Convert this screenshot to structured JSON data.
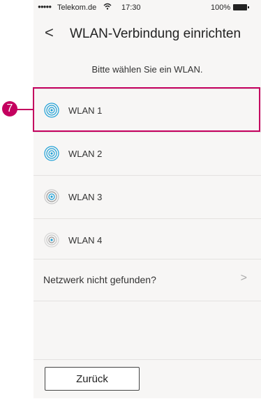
{
  "status_bar": {
    "signal_dots": "●●●●●",
    "carrier": "Telekom.de",
    "wifi_icon": "wifi-icon",
    "time": "17:30",
    "battery": "100%"
  },
  "nav": {
    "back_glyph": "<",
    "title": "WLAN-Verbindung einrichten"
  },
  "prompt": "Bitte wählen Sie ein WLAN.",
  "networks": [
    {
      "label": "WLAN 1",
      "strength": "strong"
    },
    {
      "label": "WLAN 2",
      "strength": "strong"
    },
    {
      "label": "WLAN 3",
      "strength": "medium"
    },
    {
      "label": "WLAN 4",
      "strength": "weak"
    }
  ],
  "not_found": {
    "label": "Netzwerk nicht gefunden?",
    "chevron": ">"
  },
  "footer": {
    "back_button": "Zurück"
  },
  "annotation": {
    "number": "7",
    "color": "#c4005f"
  },
  "colors": {
    "strong": "#1ea0d6",
    "medium": "#9a9a9a",
    "weak": "#c8c8c8"
  }
}
